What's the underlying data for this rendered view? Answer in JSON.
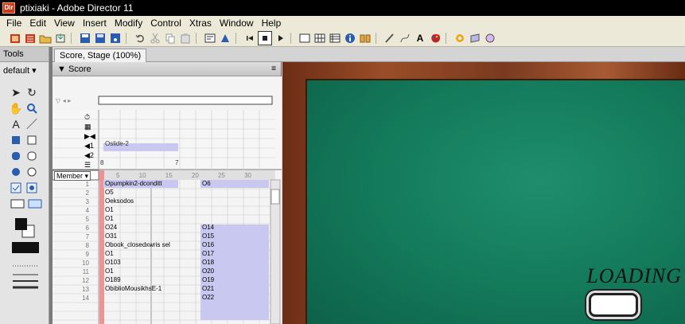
{
  "window": {
    "title": "ptixiaki - Adobe Director 11",
    "app_icon": "Dir"
  },
  "menu": [
    "File",
    "Edit",
    "View",
    "Insert",
    "Modify",
    "Control",
    "Xtras",
    "Window",
    "Help"
  ],
  "tools_panel": {
    "tab_label": "Tools",
    "selector_value": "default"
  },
  "document_tab": "Score, Stage (100%)",
  "score": {
    "header_label": "▼ Score",
    "member_select": "Member",
    "frame_ruler": [
      "5",
      "10",
      "15",
      "20",
      "25",
      "30"
    ],
    "effect_rows": [
      {
        "icon": "tempo-icon",
        "glyph": "⏱"
      },
      {
        "icon": "palette-icon",
        "glyph": "▦"
      },
      {
        "icon": "transition-icon",
        "glyph": "▶◀"
      },
      {
        "icon": "sound1-icon",
        "glyph": "◀1"
      },
      {
        "icon": "sound2-icon",
        "glyph": "◀2"
      },
      {
        "icon": "script-icon",
        "glyph": "☰"
      }
    ],
    "sound1_sprite": "Oslide-2",
    "script_marker_1": "8",
    "script_marker_2": "7",
    "channels": [
      {
        "num": "1",
        "left": "Opumpkin2-dconditt",
        "right": "O6"
      },
      {
        "num": "2",
        "left": "O5",
        "right": ""
      },
      {
        "num": "3",
        "left": "Oeksodos",
        "right": ""
      },
      {
        "num": "4",
        "left": "O1",
        "right": ""
      },
      {
        "num": "5",
        "left": "O1",
        "right": ""
      },
      {
        "num": "6",
        "left": "O24",
        "right": "O14"
      },
      {
        "num": "7",
        "left": "O31",
        "right": "O15"
      },
      {
        "num": "8",
        "left": "Obook_closedxwris sel",
        "right": "O16"
      },
      {
        "num": "9",
        "left": "O1",
        "right": "O17"
      },
      {
        "num": "10",
        "left": "O103",
        "right": "O18"
      },
      {
        "num": "11",
        "left": "O1",
        "right": "O20"
      },
      {
        "num": "12",
        "left": "O189",
        "right": "O19"
      },
      {
        "num": "13",
        "left": "ObiblioMousikhsE-1",
        "right": "O21"
      },
      {
        "num": "14",
        "left": "",
        "right": "O22"
      }
    ]
  },
  "stage": {
    "loading_text": "LOADING"
  },
  "toolbar_icons": [
    "new-movie-icon",
    "new-cast-icon",
    "open-icon",
    "import-icon",
    "save-icon",
    "save-all-icon",
    "publish-icon",
    "undo-icon",
    "cut-icon",
    "copy-icon",
    "paste-icon",
    "find-icon",
    "explore-icon",
    "rewind-icon",
    "stop-icon",
    "play-icon",
    "stage-icon",
    "cast-icon",
    "score-icon",
    "property-icon",
    "library-icon",
    "paint-icon",
    "vector-icon",
    "text-icon",
    "color-icon",
    "behavior-icon",
    "script-icon",
    "message-icon"
  ]
}
